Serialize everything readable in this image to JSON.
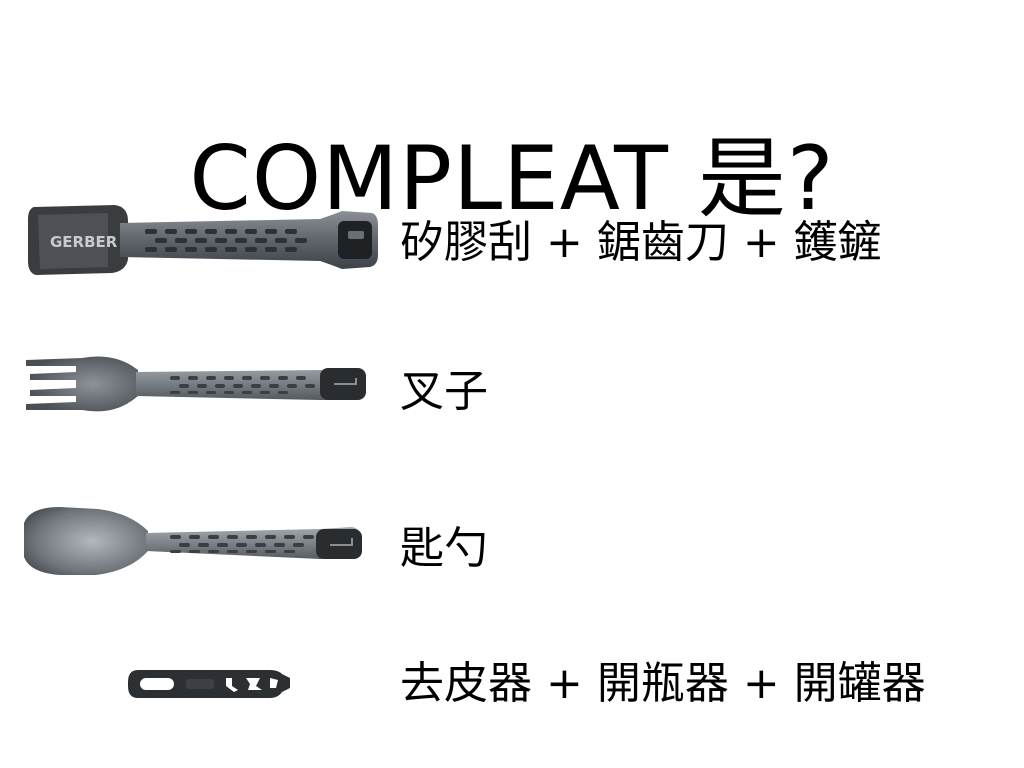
{
  "slide": {
    "title": "COMPLEAT 是?",
    "items": [
      {
        "label": "矽膠刮 + 鋸齒刀 + 鑊鏟",
        "image": "tongs-scraper-image",
        "logo_text": "GERBER"
      },
      {
        "label": "叉子",
        "image": "fork-image"
      },
      {
        "label": "匙勺",
        "image": "spoon-image"
      },
      {
        "label": "去皮器 + 開瓶器 + 開罐器",
        "image": "peeler-opener-image"
      }
    ]
  }
}
